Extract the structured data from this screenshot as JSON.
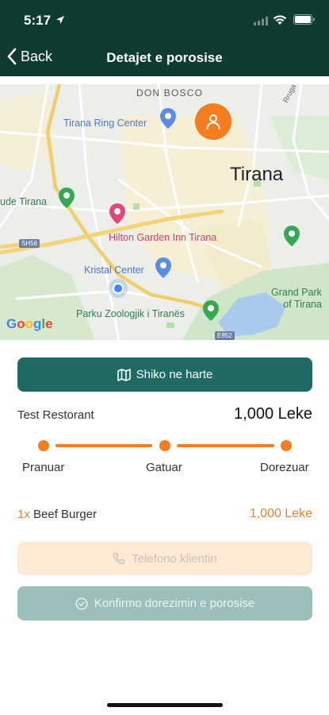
{
  "status_bar": {
    "time": "5:17"
  },
  "nav": {
    "back_label": "Back",
    "title": "Detajet e porosise"
  },
  "map": {
    "labels": {
      "don_bosco": "DON BOSCO",
      "tirana_ring_center": "Tirana Ring Center",
      "tirana": "Tirana",
      "ude_tirana": "ude Tirana",
      "hilton": "Hilton Garden Inn Tirana",
      "kristal_center": "Kristal Center",
      "parku_zoologjik": "Parku Zoologjik i Tiranës",
      "grand_park_line1": "Grand Park",
      "grand_park_line2": "of Tirana",
      "rruga": "Rruga e Dibrës",
      "sh56": "SH56",
      "e852": "E852"
    },
    "google_letters": [
      "G",
      "o",
      "o",
      "g",
      "l",
      "e"
    ],
    "colors": {
      "orange_marker": "#f37d1f",
      "gps_blue": "#4285f4"
    }
  },
  "actions": {
    "map_button_label": "Shiko ne harte",
    "phone_button_label": "Telefono klientin",
    "confirm_button_label": "Konfirmo dorezimin e porosise"
  },
  "order": {
    "restaurant": "Test Restorant",
    "total": "1,000 Leke",
    "steps": [
      "Pranuar",
      "Gatuar",
      "Dorezuar"
    ],
    "items": [
      {
        "qty": "1x",
        "name": "Beef Burger",
        "price": "1,000 Leke"
      }
    ]
  },
  "colors": {
    "header_bg": "#0f3b33",
    "primary": "#1f6b63",
    "accent": "#f37d1f",
    "phone_bg": "#fde9d4",
    "confirm_bg": "#9bbfba"
  }
}
